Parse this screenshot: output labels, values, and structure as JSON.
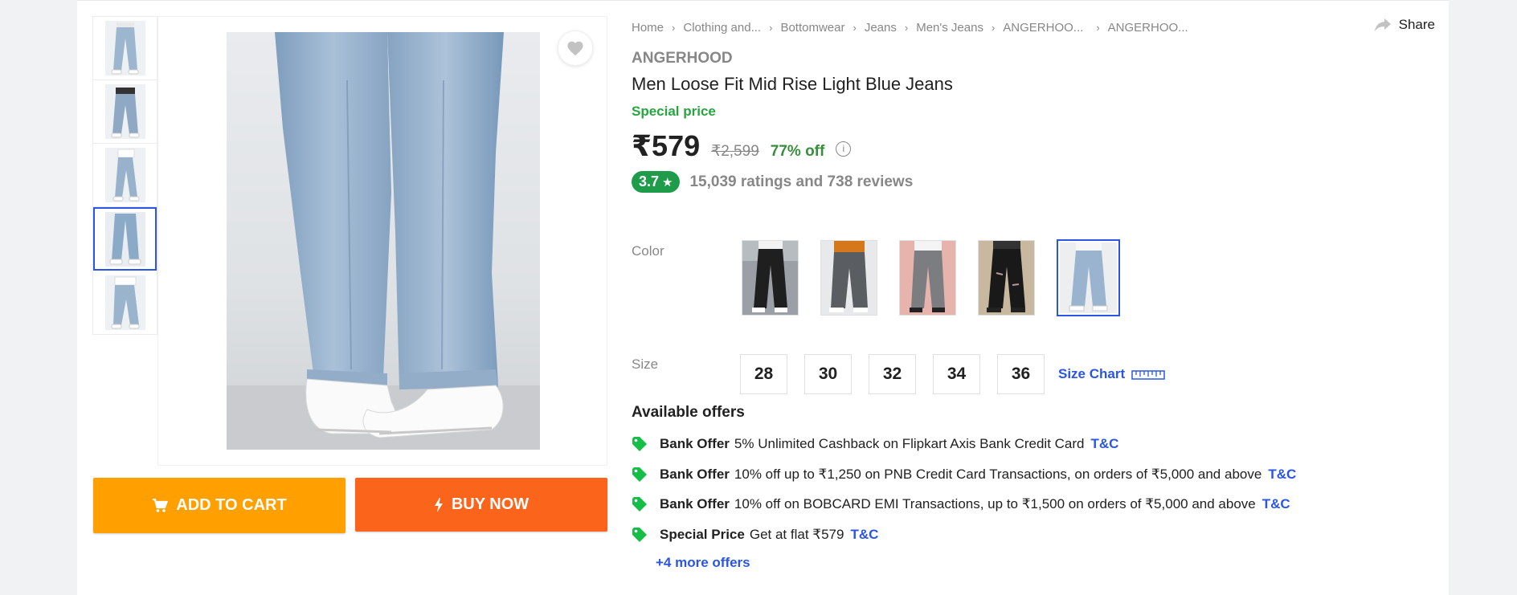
{
  "gallery": {
    "thumbnails": [
      "thumbnail-1",
      "thumbnail-2",
      "thumbnail-3",
      "thumbnail-4",
      "thumbnail-5"
    ],
    "active_index": 3,
    "wishlist_icon": "heart-icon"
  },
  "actions": {
    "add_to_cart": "ADD TO CART",
    "buy_now": "BUY NOW",
    "cart_icon": "cart-icon",
    "bolt_icon": "bolt-icon"
  },
  "breadcrumb": [
    "Home",
    "Clothing and...",
    "Bottomwear",
    "Jeans",
    "Men's Jeans",
    "ANGERHOO...",
    "ANGERHOO..."
  ],
  "share_label": "Share",
  "product": {
    "brand": "ANGERHOOD",
    "title": "Men Loose Fit Mid Rise Light Blue Jeans",
    "special_label": "Special price",
    "price": "₹579",
    "mrp": "₹2,599",
    "discount": "77% off",
    "info_icon": "i",
    "rating": "3.7",
    "rating_icon": "★",
    "rating_text": "15,039 ratings and 738 reviews"
  },
  "color": {
    "label": "Color",
    "selected_index": 4
  },
  "size": {
    "label": "Size",
    "options": [
      "28",
      "30",
      "32",
      "34",
      "36"
    ],
    "size_chart": "Size Chart"
  },
  "offers": {
    "title": "Available offers",
    "items": [
      {
        "kind": "Bank Offer",
        "text": "5% Unlimited Cashback on Flipkart Axis Bank Credit Card",
        "tc": "T&C"
      },
      {
        "kind": "Bank Offer",
        "text": "10% off up to ₹1,250 on PNB Credit Card Transactions, on orders of ₹5,000 and above",
        "tc": "T&C"
      },
      {
        "kind": "Bank Offer",
        "text": "10% off on BOBCARD EMI Transactions, up to ₹1,500 on orders of ₹5,000 and above",
        "tc": "T&C"
      },
      {
        "kind": "Special Price",
        "text": "Get at flat ₹579",
        "tc": "T&C"
      }
    ],
    "more": "+4 more offers"
  },
  "colors": {
    "accent": "#2a55e5",
    "cart": "#ff9f00",
    "buy": "#fb641b",
    "green": "#26a541"
  }
}
